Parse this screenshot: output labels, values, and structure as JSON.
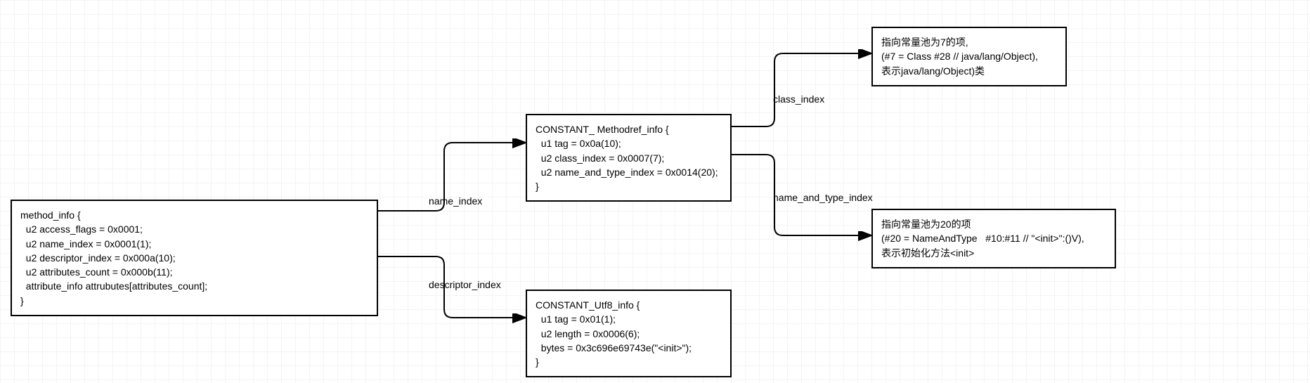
{
  "nodes": {
    "method_info": "method_info {\n  u2 access_flags = 0x0001;\n  u2 name_index = 0x0001(1);\n  u2 descriptor_index = 0x000a(10);\n  u2 attributes_count = 0x000b(11);\n  attribute_info attrubutes[attributes_count];\n}",
    "methodref": "CONSTANT_ Methodref_info {\n  u1 tag = 0x0a(10);\n  u2 class_index = 0x0007(7);\n  u2 name_and_type_index = 0x0014(20);\n}",
    "utf8": "CONSTANT_Utf8_info {\n  u1 tag = 0x01(1);\n  u2 length = 0x0006(6);\n  bytes = 0x3c696e69743e(\"<init>\");\n}",
    "class_desc": "指向常量池为7的项,\n(#7 = Class #28 // java/lang/Object),\n表示java/lang/Object)类",
    "nat_desc": "指向常量池为20的项\n(#20 = NameAndType   #10:#11 // \"<init>\":()V),\n表示初始化方法<init>"
  },
  "edges": {
    "name_index": "name_index",
    "descriptor_index": "descriptor_index",
    "class_index": "class_index",
    "name_and_type_index": "name_and_type_index"
  }
}
